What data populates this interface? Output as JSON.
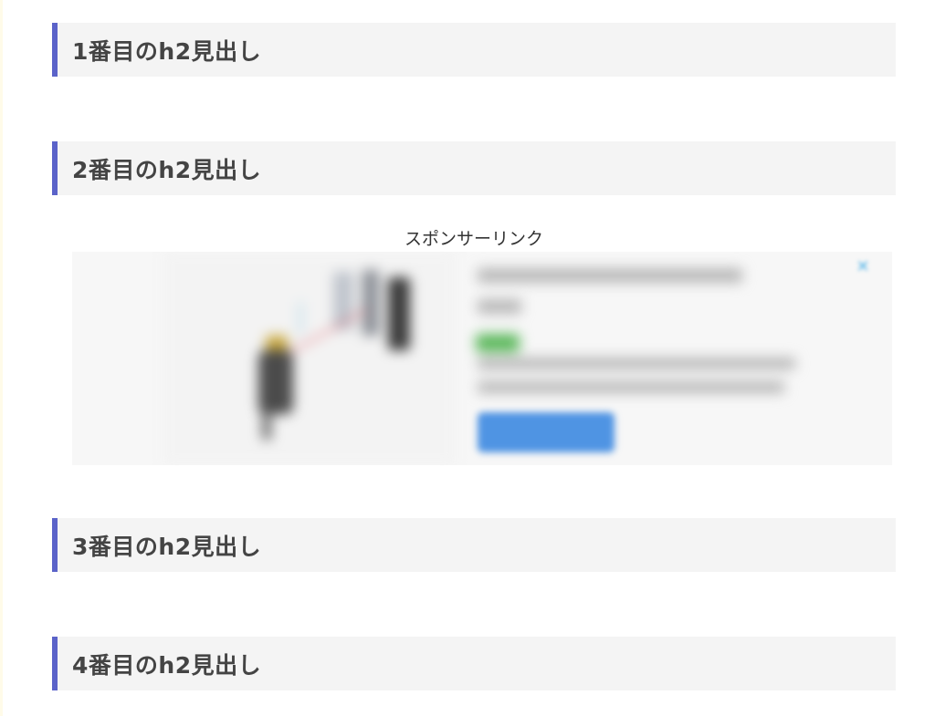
{
  "headings": [
    {
      "text": "1番目のh2見出し"
    },
    {
      "text": "2番目のh2見出し"
    },
    {
      "text": "3番目のh2見出し"
    },
    {
      "text": "4番目のh2見出し"
    }
  ],
  "sponsor": {
    "label": "スポンサーリンク"
  },
  "colors": {
    "heading_accent": "#5b63c9",
    "heading_background": "#f4f4f4",
    "heading_text": "#444444",
    "ad_cta": "#4f94e3",
    "ad_badge": "#5cb85c"
  },
  "ad": {
    "close_icon": "ad-choices-close-icon",
    "image_icon": "laser-sensor-product-image"
  }
}
